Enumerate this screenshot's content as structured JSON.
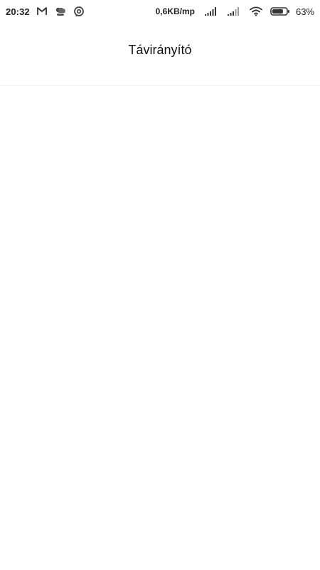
{
  "status_bar": {
    "time": "20:32",
    "network_speed": "0,6KB/mp",
    "battery_percent": "63%",
    "icons": [
      "gmail-icon",
      "weather-icon",
      "sync-icon",
      "signal-icon",
      "signal-icon-2",
      "wifi-icon",
      "battery-icon"
    ]
  },
  "app_bar": {
    "title": "Távirányító"
  }
}
